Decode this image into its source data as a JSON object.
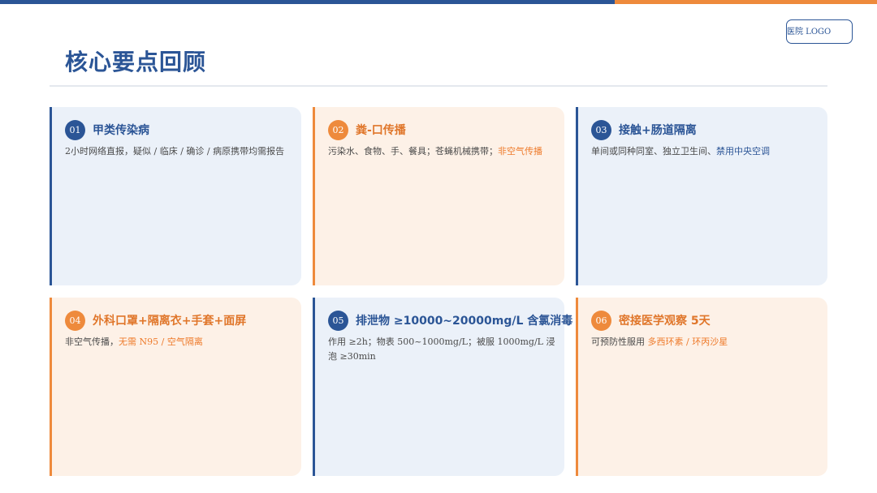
{
  "colors": {
    "primary_blue": "#2b5596",
    "accent_orange": "#ee8a3c"
  },
  "logo": {
    "text": "医院 LOGO"
  },
  "page": {
    "title": "核心要点回顾"
  },
  "cards": [
    {
      "num": "01",
      "title": "甲类传染病",
      "desc": "2小时网络直报，疑似 / 临床 / 确诊 / 病原携带均需报告",
      "highlight": ""
    },
    {
      "num": "02",
      "title": "粪-口传播",
      "desc": "污染水、食物、手、餐具；苍蝇机械携带；",
      "highlight": "非空气传播"
    },
    {
      "num": "03",
      "title": "接触+肠道隔离",
      "desc": "单间或同种同室、独立卫生间、",
      "highlight": "禁用中央空调"
    },
    {
      "num": "04",
      "title": "外科口罩+隔离衣+手套+面屏",
      "desc": "非空气传播，",
      "highlight": "无需 N95 / 空气隔离"
    },
    {
      "num": "05",
      "title": "排泄物 ≥10000~20000mg/L 含氯消毒",
      "desc": "作用 ≥2h；物表 500~1000mg/L；被服 1000mg/L 浸泡 ≥30min",
      "highlight": ""
    },
    {
      "num": "06",
      "title": "密接医学观察 5天",
      "desc": "可预防性服用 ",
      "highlight": "多西环素 / 环丙沙星"
    }
  ]
}
